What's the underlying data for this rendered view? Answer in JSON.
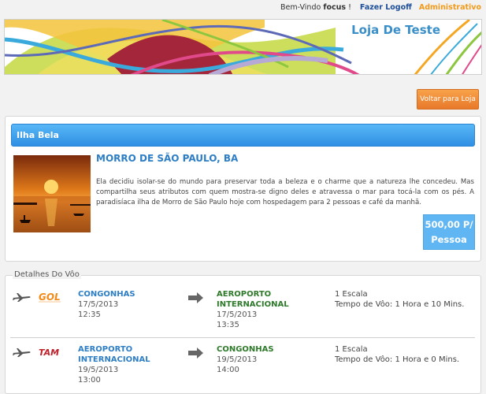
{
  "topbar": {
    "welcome": "Bem-Vindo",
    "user": "focus",
    "exclaim": "!",
    "logoff": "Fazer Logoff",
    "admin": "Administrativo"
  },
  "banner": {
    "store_title": "Loja De Teste"
  },
  "back_button": "Voltar para Loja",
  "package": {
    "header": "Ilha Bela",
    "title": "MORRO DE SÃO PAULO, BA",
    "description": "Ela decidiu isolar-se do mundo para preservar toda a beleza e o charme que a natureza lhe concedeu. Mas compartilha seus atributos com quem mostra-se digno deles e atravessa o mar para tocá-la com os pés. A paradisíaca ilha de Morro de São Paulo hoje com hospedagem para 2 pessoas e café da manhã.",
    "price_line1": "500,00 P/",
    "price_line2": "Pessoa"
  },
  "flights": {
    "legend": "Detalhes Do Vôo",
    "rows": [
      {
        "airline": "GOL",
        "from_airport": "CONGONHAS",
        "from_date": "17/5/2013",
        "from_time": "12:35",
        "to_airport_line1": "AEROPORTO",
        "to_airport_line2": "INTERNACIONAL",
        "to_date": "17/5/2013",
        "to_time": "13:35",
        "stops": "1 Escala",
        "duration": "Tempo de Vôo: 1 Hora e 10 Mins."
      },
      {
        "airline": "TAM",
        "from_airport_line1": "AEROPORTO",
        "from_airport_line2": "INTERNACIONAL",
        "from_date": "19/5/2013",
        "from_time": "13:00",
        "to_airport": "CONGONHAS",
        "to_date": "19/5/2013",
        "to_time": "14:00",
        "stops": "1 Escala",
        "duration": "Tempo de Vôo: 1 Hora e 0 Mins."
      }
    ]
  },
  "colors": {
    "accent_blue": "#2d7ec4",
    "orange": "#e8792a",
    "green": "#2e7a2a"
  }
}
